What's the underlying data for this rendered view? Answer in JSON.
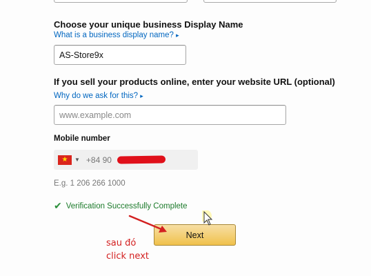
{
  "display_name": {
    "label": "Choose your unique business Display Name",
    "help_link": "What is a business display name?",
    "value": "AS-Store9x"
  },
  "website": {
    "label": "If you sell your products online, enter your website URL (optional)",
    "help_link": "Why do we ask for this?",
    "placeholder": "www.example.com"
  },
  "mobile": {
    "label": "Mobile number",
    "country_icon": "vietnam-flag-icon",
    "prefix": "+84 90",
    "example": "E.g. 1 206 266 1000"
  },
  "verification": {
    "icon": "checkmark-icon",
    "text": "Verification Successfully Complete"
  },
  "next_button": {
    "label": "Next"
  },
  "annotation": {
    "line1": "sau đó",
    "line2": "click next",
    "color": "#d32020"
  },
  "colors": {
    "link": "#0066c0",
    "success": "#1b7a2a",
    "button": "#f0c14b",
    "redaction": "#e0101a"
  }
}
